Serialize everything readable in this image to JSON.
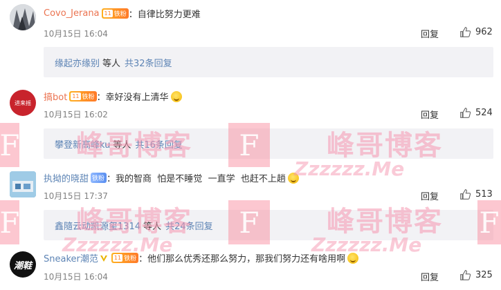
{
  "comments": [
    {
      "username": "Covo_Jerana",
      "badge_level": "11",
      "badge_text": "铁粉",
      "text": "自律比努力更难",
      "time": "10月15日 16:04",
      "reply_label": "回复",
      "likes": "962",
      "sub": {
        "who": "缘起亦缘别",
        "etc": "等人",
        "total": "共32条回复"
      }
    },
    {
      "username": "搞bot",
      "badge_level": "11",
      "badge_text": "铁粉",
      "text": "幸好没有上清华",
      "time": "10月15日 16:02",
      "reply_label": "回复",
      "likes": "524",
      "sub": {
        "who": "攀登新高峰ku",
        "etc": "等人",
        "total": "共16条回复"
      }
    },
    {
      "username": "执拗的晓甜",
      "badge_level": "",
      "badge_text": "铁粉",
      "text": "我的智商  怕是不睡觉  一直学  也赶不上趟",
      "time": "10月15日 17:37",
      "reply_label": "回复",
      "likes": "513",
      "sub": {
        "who": "鑫隨云动凯源玺1314",
        "etc": "等人",
        "total": "共24条回复"
      }
    },
    {
      "username": "Sneaker潮范",
      "badge_level": "11",
      "badge_text": "铁粉",
      "text": "他们那么优秀还那么努力，那我们努力还有啥用啊",
      "time": "10月15日 16:04",
      "reply_label": "回复",
      "likes": "325"
    }
  ],
  "avatar_text_2": "进来摇",
  "avatar_text_4": "潮鞋",
  "watermark": {
    "letter": "F",
    "text": "峰哥博客",
    "site": "Zzzzzz.Me"
  },
  "colors": {
    "username": "#eb7350",
    "link": "#5d84b5",
    "muted": "#808080",
    "subbox": "#f2f2f5"
  }
}
